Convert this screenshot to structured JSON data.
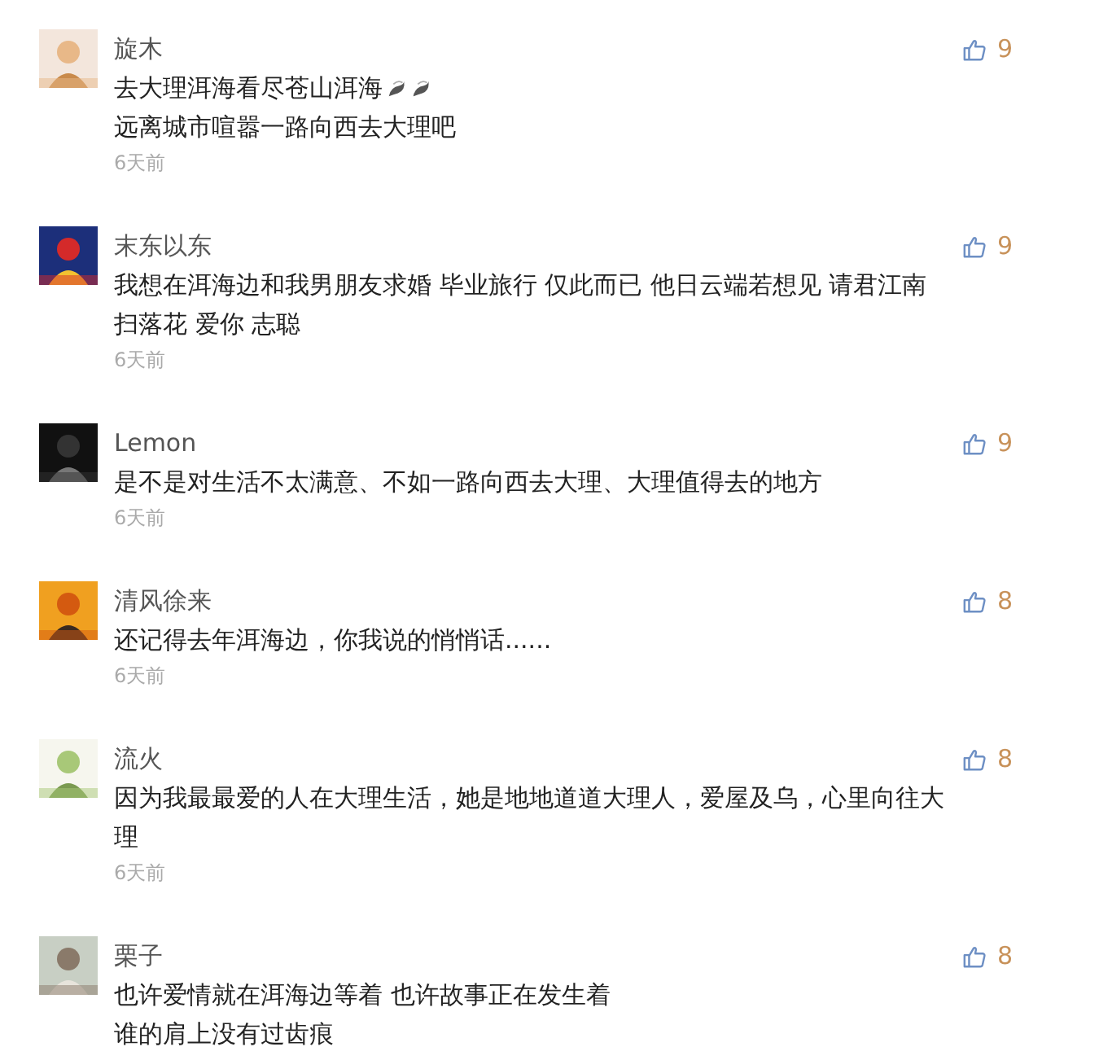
{
  "comments": [
    {
      "author": "旋木",
      "likes": "9",
      "lines": [
        {
          "text": "去大理洱海看尽苍山洱海",
          "icons": [
            {
              "kind": "leaf"
            },
            {
              "kind": "leaf"
            }
          ]
        },
        {
          "text": "远离城市喧嚣一路向西去大理吧"
        }
      ],
      "time": "6天前"
    },
    {
      "author": "末东以东",
      "likes": "9",
      "lines": [
        {
          "text": "我想在洱海边和我男朋友求婚 毕业旅行 仅此而已 他日云端若想见 请君江南"
        },
        {
          "text": "扫落花 爱你 志聪"
        }
      ],
      "time": "6天前"
    },
    {
      "author": "Lemon",
      "likes": "9",
      "lines": [
        {
          "text": "是不是对生活不太满意、不如一路向西去大理、大理值得去的地方"
        }
      ],
      "time": "6天前"
    },
    {
      "author": "清风徐来",
      "likes": "8",
      "lines": [
        {
          "text": "还记得去年洱海边，你我说的悄悄话......"
        }
      ],
      "time": "6天前"
    },
    {
      "author": "流火",
      "likes": "8",
      "lines": [
        {
          "text": "因为我最最爱的人在大理生活，她是地地道道大理人，爱屋及乌，心里向往大"
        },
        {
          "text": "理"
        }
      ],
      "time": "6天前"
    },
    {
      "author": "栗子",
      "likes": "8",
      "lines": [
        {
          "text": "也许爱情就在洱海边等着 也许故事正在发生着"
        },
        {
          "text": "谁的肩上没有过齿痕"
        }
      ]
    }
  ]
}
